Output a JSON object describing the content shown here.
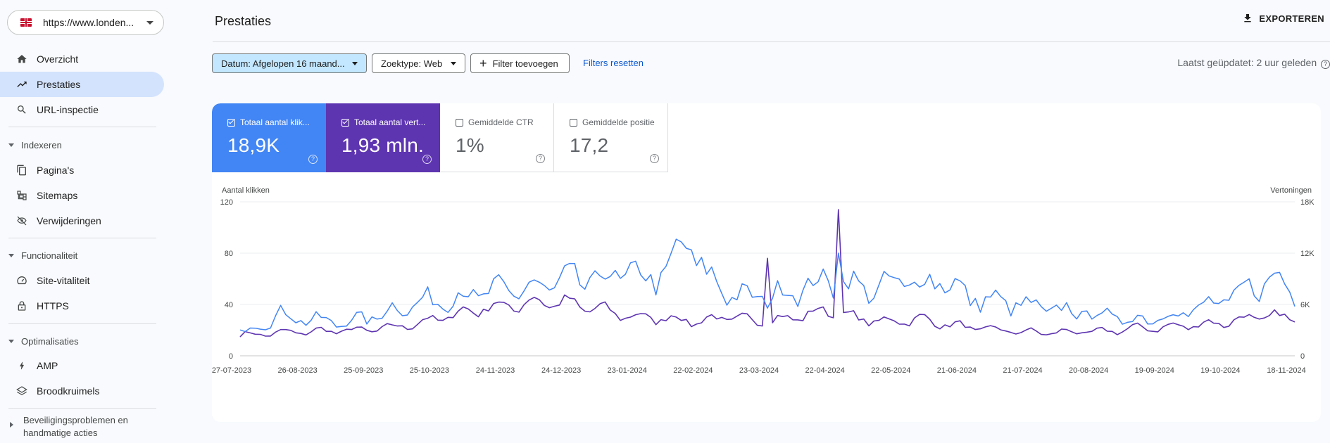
{
  "property": {
    "url": "https://www.londen...",
    "flag": "uk-flag-icon"
  },
  "sidebar": {
    "items_top": [
      {
        "label": "Overzicht",
        "icon": "home-icon"
      },
      {
        "label": "Prestaties",
        "icon": "trending-up-icon",
        "active": true
      },
      {
        "label": "URL-inspectie",
        "icon": "search-icon"
      }
    ],
    "sections": [
      {
        "title": "Indexeren",
        "items": [
          {
            "label": "Pagina's",
            "icon": "pages-icon"
          },
          {
            "label": "Sitemaps",
            "icon": "sitemap-icon"
          },
          {
            "label": "Verwijderingen",
            "icon": "eye-off-icon"
          }
        ]
      },
      {
        "title": "Functionaliteit",
        "items": [
          {
            "label": "Site-vitaliteit",
            "icon": "gauge-icon"
          },
          {
            "label": "HTTPS",
            "icon": "lock-icon"
          }
        ]
      },
      {
        "title": "Optimalisaties",
        "items": [
          {
            "label": "AMP",
            "icon": "bolt-icon"
          },
          {
            "label": "Broodkruimels",
            "icon": "layers-icon"
          }
        ]
      }
    ],
    "security_line1": "Beveiligingsproblemen en",
    "security_line2": "handmatige acties"
  },
  "header": {
    "title": "Prestaties",
    "export_label": "EXPORTEREN"
  },
  "filters": {
    "date": "Datum: Afgelopen 16 maand...",
    "search_type": "Zoektype: Web",
    "add_filter": "Filter toevoegen",
    "reset": "Filters resetten",
    "last_updated": "Laatst geüpdatet: 2 uur geleden"
  },
  "metrics": [
    {
      "label": "Totaal aantal klik...",
      "value": "18,9K",
      "checked": true,
      "color": "#4285f4"
    },
    {
      "label": "Totaal aantal vert...",
      "value": "1,93 mln.",
      "checked": true,
      "color": "#5e35b1"
    },
    {
      "label": "Gemiddelde CTR",
      "value": "1%",
      "checked": false
    },
    {
      "label": "Gemiddelde positie",
      "value": "17,2",
      "checked": false
    }
  ],
  "chart_data": {
    "type": "line",
    "left_axis_label": "Aantal klikken",
    "right_axis_label": "Vertoningen",
    "left_ticks": [
      "0",
      "40",
      "80",
      "120"
    ],
    "right_ticks": [
      "0",
      "6K",
      "12K",
      "18K"
    ],
    "ylim_left": [
      0,
      120
    ],
    "ylim_right": [
      0,
      18000
    ],
    "grid": true,
    "x_ticks": [
      "27-07-2023",
      "26-08-2023",
      "25-09-2023",
      "25-10-2023",
      "24-11-2023",
      "24-12-2023",
      "23-01-2024",
      "22-02-2024",
      "23-03-2024",
      "22-04-2024",
      "22-05-2024",
      "21-06-2024",
      "21-07-2024",
      "20-08-2024",
      "19-09-2024",
      "19-10-2024",
      "18-11-2024"
    ],
    "series": [
      {
        "name": "Totaal aantal klikken",
        "axis": "left",
        "color": "#4285f4",
        "anchors": [
          [
            0,
            18
          ],
          [
            4,
            25
          ],
          [
            8,
            32
          ],
          [
            14,
            28
          ],
          [
            20,
            26
          ],
          [
            26,
            30
          ],
          [
            30,
            36
          ],
          [
            36,
            42
          ],
          [
            40,
            44
          ],
          [
            46,
            48
          ],
          [
            50,
            50
          ],
          [
            56,
            52
          ],
          [
            60,
            54
          ],
          [
            66,
            60
          ],
          [
            70,
            58
          ],
          [
            76,
            65
          ],
          [
            80,
            60
          ],
          [
            84,
            64
          ],
          [
            88,
            90
          ],
          [
            92,
            62
          ],
          [
            96,
            50
          ],
          [
            100,
            45
          ],
          [
            106,
            48
          ],
          [
            110,
            52
          ],
          [
            116,
            58
          ],
          [
            120,
            55
          ],
          [
            126,
            52
          ],
          [
            130,
            58
          ],
          [
            134,
            55
          ],
          [
            138,
            62
          ],
          [
            140,
            56
          ],
          [
            144,
            45
          ],
          [
            150,
            42
          ],
          [
            156,
            38
          ],
          [
            160,
            36
          ],
          [
            166,
            34
          ],
          [
            170,
            32
          ],
          [
            176,
            28
          ],
          [
            180,
            30
          ],
          [
            186,
            34
          ],
          [
            190,
            38
          ],
          [
            196,
            45
          ],
          [
            200,
            55
          ],
          [
            204,
            60
          ],
          [
            208,
            50
          ]
        ]
      },
      {
        "name": "Vertoningen",
        "axis": "right",
        "color": "#5e35b1",
        "anchors": [
          [
            0,
            2400
          ],
          [
            8,
            2700
          ],
          [
            16,
            2900
          ],
          [
            24,
            3000
          ],
          [
            30,
            3300
          ],
          [
            36,
            3900
          ],
          [
            42,
            4800
          ],
          [
            48,
            5600
          ],
          [
            54,
            5900
          ],
          [
            60,
            6400
          ],
          [
            66,
            6000
          ],
          [
            72,
            5300
          ],
          [
            78,
            4500
          ],
          [
            84,
            4400
          ],
          [
            90,
            4000
          ],
          [
            96,
            4500
          ],
          [
            102,
            4100
          ],
          [
            108,
            4300
          ],
          [
            112,
            4900
          ],
          [
            116,
            5200
          ],
          [
            122,
            4300
          ],
          [
            128,
            4000
          ],
          [
            134,
            4300
          ],
          [
            140,
            3600
          ],
          [
            146,
            3200
          ],
          [
            152,
            2900
          ],
          [
            158,
            2700
          ],
          [
            164,
            2800
          ],
          [
            170,
            2800
          ],
          [
            176,
            3200
          ],
          [
            182,
            3300
          ],
          [
            188,
            3600
          ],
          [
            194,
            3900
          ],
          [
            200,
            4500
          ],
          [
            204,
            4600
          ],
          [
            208,
            4300
          ]
        ]
      }
    ],
    "peaks": [
      {
        "series": "Vertoningen",
        "x_index": 118,
        "value": 17100
      },
      {
        "series": "Vertoningen",
        "x_index": 104,
        "value": 11400
      },
      {
        "series": "Totaal aantal klikken",
        "x_index": 118,
        "value": 80
      }
    ]
  }
}
